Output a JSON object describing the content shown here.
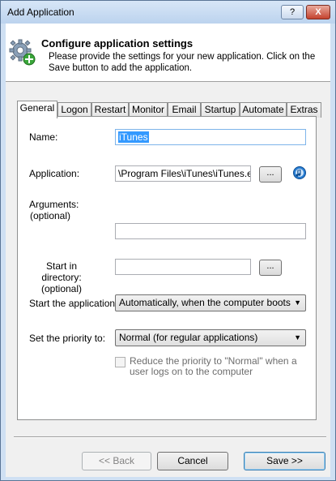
{
  "window": {
    "title": "Add Application",
    "help_label": "?",
    "close_label": "X"
  },
  "header": {
    "title": "Configure application settings",
    "subtitle": "Please provide the settings for your new application. Click on the Save button to add the application."
  },
  "tabs": [
    {
      "label": "General",
      "active": true
    },
    {
      "label": "Logon"
    },
    {
      "label": "Restart"
    },
    {
      "label": "Monitor"
    },
    {
      "label": "Email"
    },
    {
      "label": "Startup"
    },
    {
      "label": "Automate"
    },
    {
      "label": "Extras"
    }
  ],
  "form": {
    "name_label": "Name:",
    "name_value": "iTunes",
    "application_label": "Application:",
    "application_value": "\\Program Files\\iTunes\\iTunes.exe",
    "browse_label": "...",
    "arguments_label": "Arguments:",
    "arguments_optional": "(optional)",
    "arguments_value": "",
    "start_dir_label": "Start in directory:",
    "start_dir_optional": "(optional)",
    "start_dir_value": "",
    "start_app_label": "Start the application:",
    "start_app_value": "Automatically, when the computer boots",
    "priority_label": "Set the priority to:",
    "priority_value": "Normal (for regular applications)",
    "reduce_priority_label": "Reduce the priority to \"Normal\" when a user logs on to the computer",
    "reduce_priority_checked": false
  },
  "buttons": {
    "back": "<< Back",
    "cancel": "Cancel",
    "save": "Save >>"
  },
  "colors": {
    "selection": "#3399ff",
    "title_bar": "#bcd3ee",
    "close_button": "#c4422e"
  },
  "icons": {
    "header": "gear-add-icon",
    "app": "itunes-note-icon",
    "combo": "chevron-down-icon"
  }
}
